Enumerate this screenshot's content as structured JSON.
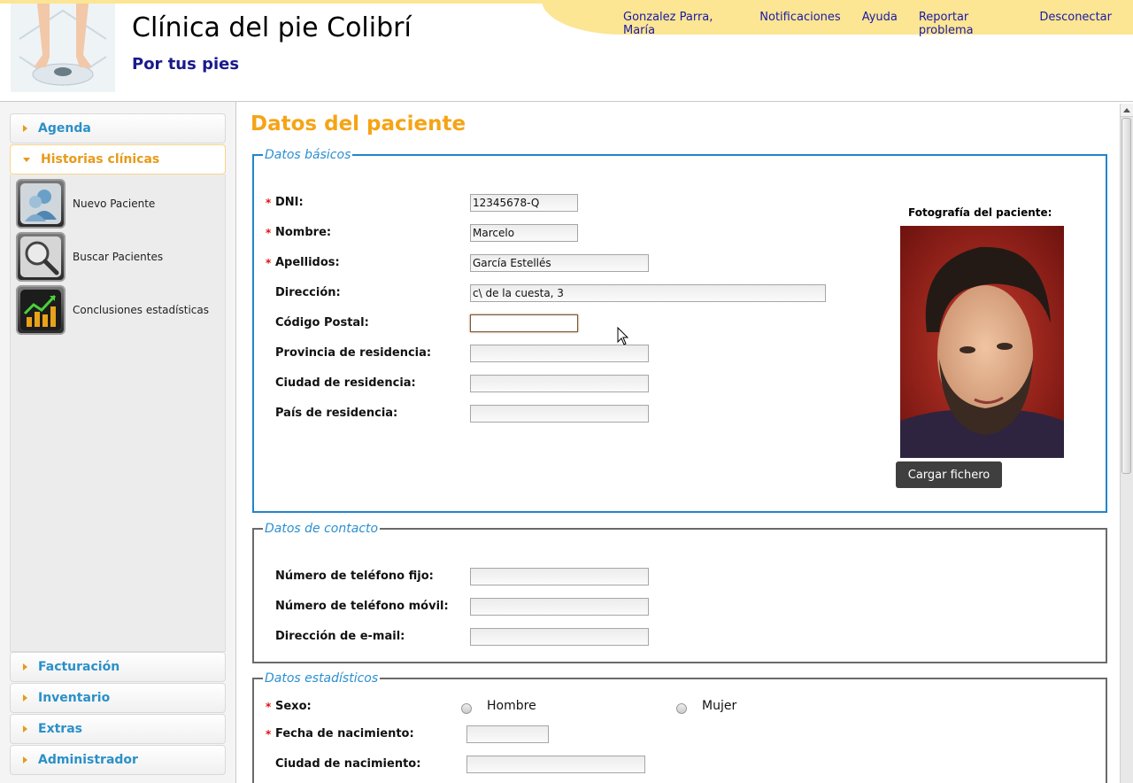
{
  "header": {
    "title": "Clínica del pie Colibrí",
    "tagline": "Por tus pies",
    "links": [
      "Gonzalez Parra, María",
      "Notificaciones",
      "Ayuda",
      "Reportar problema",
      "Desconectar"
    ]
  },
  "sidebar": {
    "sections": [
      {
        "label": "Agenda",
        "open": false
      },
      {
        "label": "Historias clínicas",
        "open": true
      },
      {
        "label": "Facturación",
        "open": false
      },
      {
        "label": "Inventario",
        "open": false
      },
      {
        "label": "Extras",
        "open": false
      },
      {
        "label": "Administrador",
        "open": false
      }
    ],
    "submenu": [
      {
        "label": "Nuevo Paciente",
        "icon": "users-icon"
      },
      {
        "label": "Buscar Pacientes",
        "icon": "magnifier-icon"
      },
      {
        "label": "Conclusiones estadísticas",
        "icon": "chart-icon"
      }
    ]
  },
  "page": {
    "title": "Datos del paciente"
  },
  "basicos": {
    "legend": "Datos básicos",
    "fields": [
      {
        "label": "DNI:",
        "value": "12345678-Q",
        "required": true
      },
      {
        "label": "Nombre:",
        "value": "Marcelo",
        "required": true
      },
      {
        "label": "Apellidos:",
        "value": "García Estellés",
        "required": true
      },
      {
        "label": "Dirección:",
        "value": "c\\ de la cuesta, 3",
        "required": false
      },
      {
        "label": "Código Postal:",
        "value": "",
        "required": false
      },
      {
        "label": "Provincia de residencia:",
        "value": "",
        "required": false
      },
      {
        "label": "Ciudad de residencia:",
        "value": "",
        "required": false
      },
      {
        "label": "País de residencia:",
        "value": "",
        "required": false
      }
    ],
    "photo_label": "Fotografía del paciente:",
    "upload_button": "Cargar fichero"
  },
  "contacto": {
    "legend": "Datos de contacto",
    "fields": [
      {
        "label": "Número de teléfono fijo:",
        "value": ""
      },
      {
        "label": "Número de teléfono móvil:",
        "value": ""
      },
      {
        "label": "Dirección de e-mail:",
        "value": ""
      }
    ]
  },
  "estadisticos": {
    "legend": "Datos estadísticos",
    "sexo_label": "Sexo:",
    "sexo_options": [
      "Hombre",
      "Mujer"
    ],
    "fecha_label": "Fecha de nacimiento:",
    "fecha_value": "",
    "ciudad_label": "Ciudad de nacimiento:",
    "ciudad_value": ""
  },
  "colors": {
    "accent_orange": "#f5a416",
    "link_blue": "#2b90c8",
    "legend_blue": "#2b8fd1",
    "header_yellow": "#fce593",
    "required_red": "#dd1111"
  }
}
